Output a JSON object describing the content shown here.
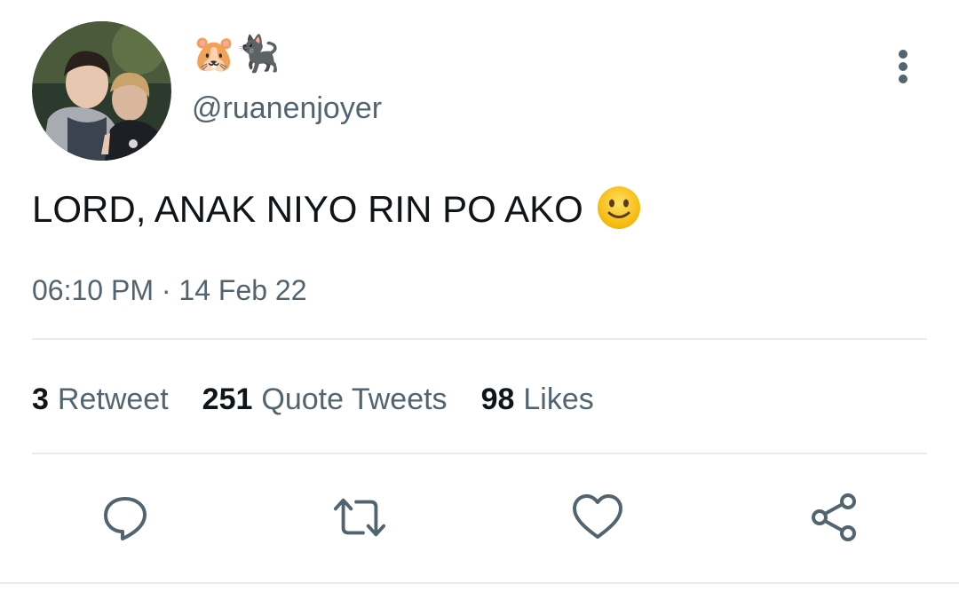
{
  "author": {
    "display_name": "🐹🐈‍⬛",
    "handle": "@ruanenjoyer"
  },
  "tweet": {
    "text": "LORD, ANAK NIYO RIN PO AKO",
    "emoji": "slightly-smiling-face",
    "timestamp": "06:10 PM · 14 Feb 22"
  },
  "stats": [
    {
      "count": "3",
      "label": "Retweet"
    },
    {
      "count": "251",
      "label": "Quote Tweets"
    },
    {
      "count": "98",
      "label": "Likes"
    }
  ],
  "actions": [
    "reply-icon",
    "retweet-icon",
    "like-icon",
    "share-icon"
  ],
  "colors": {
    "text": "#0f1419",
    "secondary": "#536471",
    "divider": "#e6ecf0",
    "icon": "#536471"
  }
}
